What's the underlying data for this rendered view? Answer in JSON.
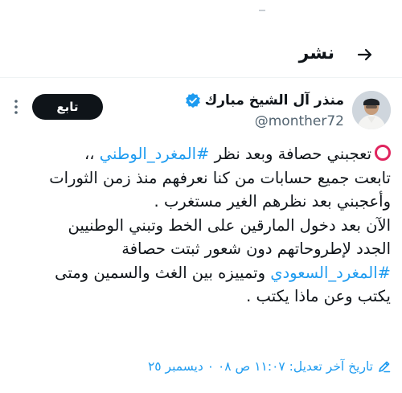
{
  "header": {
    "title": "نشر",
    "back_icon": "arrow-right-icon"
  },
  "tweet": {
    "author_name": "منذر آل الشيخ مبارك",
    "handle": "@monther72",
    "follow_label": "تابع",
    "body": {
      "line1_text": "تعجبني حصافة وبعد نظر ",
      "line1_hashtag": "#المغرد_الوطني",
      "line1_tail": " ،،",
      "line2": "تابعت جميع حسابات من كنا نعرفهم منذ زمن الثورات",
      "line3": "وأعجبني بعد نظرهم الغير مستغرب .",
      "line4": "الآن بعد دخول المارقين على الخط وتبني الوطنيين",
      "line5": "الجدد لإطروحاتهم دون شعور ثبتت حصافة",
      "line6_hashtag": "#المغرد_السعودي",
      "line6_tail": " وتمييزه بين الغث والسمين ومتى",
      "line7": "يكتب وعن ماذا يكتب ."
    },
    "edited_label": "تاريخ آخر تعديل: ١١:٠٧ ص ٠٨ ٠ ديسمبر ٢٥"
  },
  "colors": {
    "accent": "#1d9bf0",
    "verified": "#1d9bf0",
    "red_circle": "#e0245e",
    "follow_bg": "#0f1419"
  }
}
